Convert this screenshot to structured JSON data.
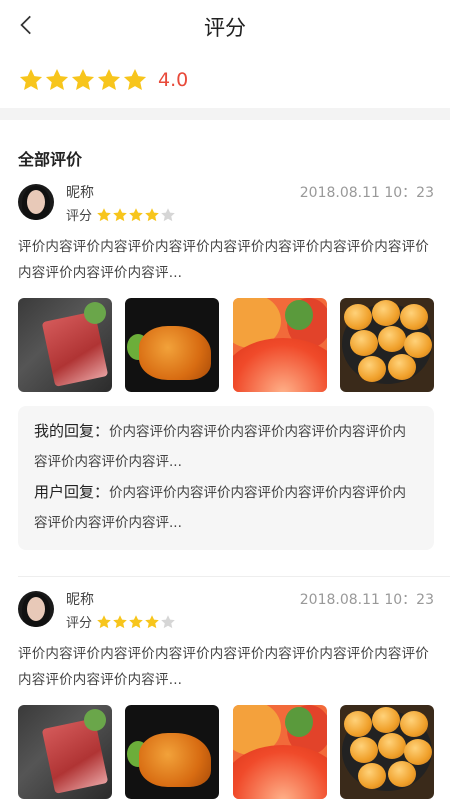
{
  "header": {
    "title": "评分"
  },
  "summary": {
    "rating": 4.0,
    "rating_text": "4.0",
    "max": 5
  },
  "section": {
    "title": "全部评价"
  },
  "colors": {
    "star_on": "#f7c51c",
    "star_off": "#d6d6d6",
    "accent": "#e84a3a"
  },
  "reviews": [
    {
      "nickname": "昵称",
      "date": "2018.08.11 10：23",
      "rate_label": "评分",
      "stars": 4,
      "content": "评价内容评价内容评价内容评价内容评价内容评价内容评价内容评价内容评价内容评价内容评...",
      "photos": [
        "steak",
        "fried-chicken",
        "grapefruit",
        "buns"
      ],
      "reply": {
        "my_label": "我的回复：",
        "my_text": "价内容评价内容评价内容评价内容评价内容评价内容评价内容评价内容评...",
        "user_label": "用户回复：",
        "user_text": "价内容评价内容评价内容评价内容评价内容评价内容评价内容评价内容评..."
      }
    },
    {
      "nickname": "昵称",
      "date": "2018.08.11 10：23",
      "rate_label": "评分",
      "stars": 4,
      "content": "评价内容评价内容评价内容评价内容评价内容评价内容评价内容评价内容评价内容评价内容评...",
      "photos": [
        "steak",
        "fried-chicken",
        "grapefruit",
        "buns"
      ]
    }
  ]
}
